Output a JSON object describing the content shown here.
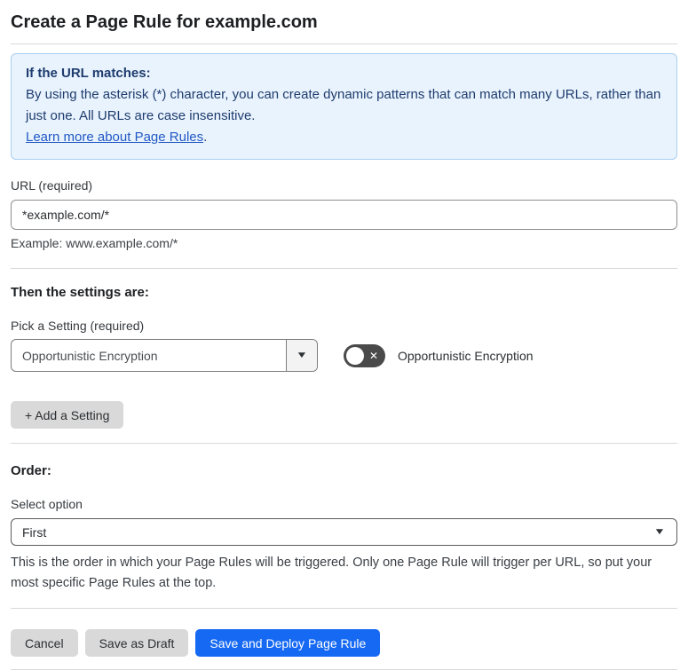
{
  "page": {
    "title": "Create a Page Rule for example.com"
  },
  "info_box": {
    "heading": "If the URL matches:",
    "body": "By using the asterisk (*) character, you can create dynamic patterns that can match many URLs, rather than just one. All URLs are case insensitive.",
    "link_label": "Learn more about Page Rules",
    "link_suffix": "."
  },
  "url_field": {
    "label": "URL (required)",
    "value": "*example.com/*",
    "helper": "Example: www.example.com/*"
  },
  "settings_section": {
    "heading": "Then the settings are:",
    "pick_label": "Pick a Setting (required)",
    "selected_setting": "Opportunistic Encryption",
    "toggle_label": "Opportunistic Encryption",
    "toggle_state": "off",
    "add_setting_label": "+ Add a Setting"
  },
  "order_section": {
    "heading": "Order:",
    "select_label": "Select option",
    "selected_option": "First",
    "helper": "This is the order in which your Page Rules will be triggered. Only one Page Rule will trigger per URL, so put your most specific Page Rules at the top."
  },
  "footer": {
    "cancel_label": "Cancel",
    "save_draft_label": "Save as Draft",
    "save_deploy_label": "Save and Deploy Page Rule"
  },
  "icons": {
    "dropdown_caret": "▼",
    "toggle_off_x": "✕"
  },
  "colors": {
    "accent_blue": "#1669f2",
    "info_background": "#e9f3fd",
    "info_border": "#a9cdf0",
    "info_text": "#1e3c6e",
    "link_blue": "#2158c4",
    "toggle_off_background": "#4a4a4a",
    "button_gray": "#d9d9d9"
  }
}
